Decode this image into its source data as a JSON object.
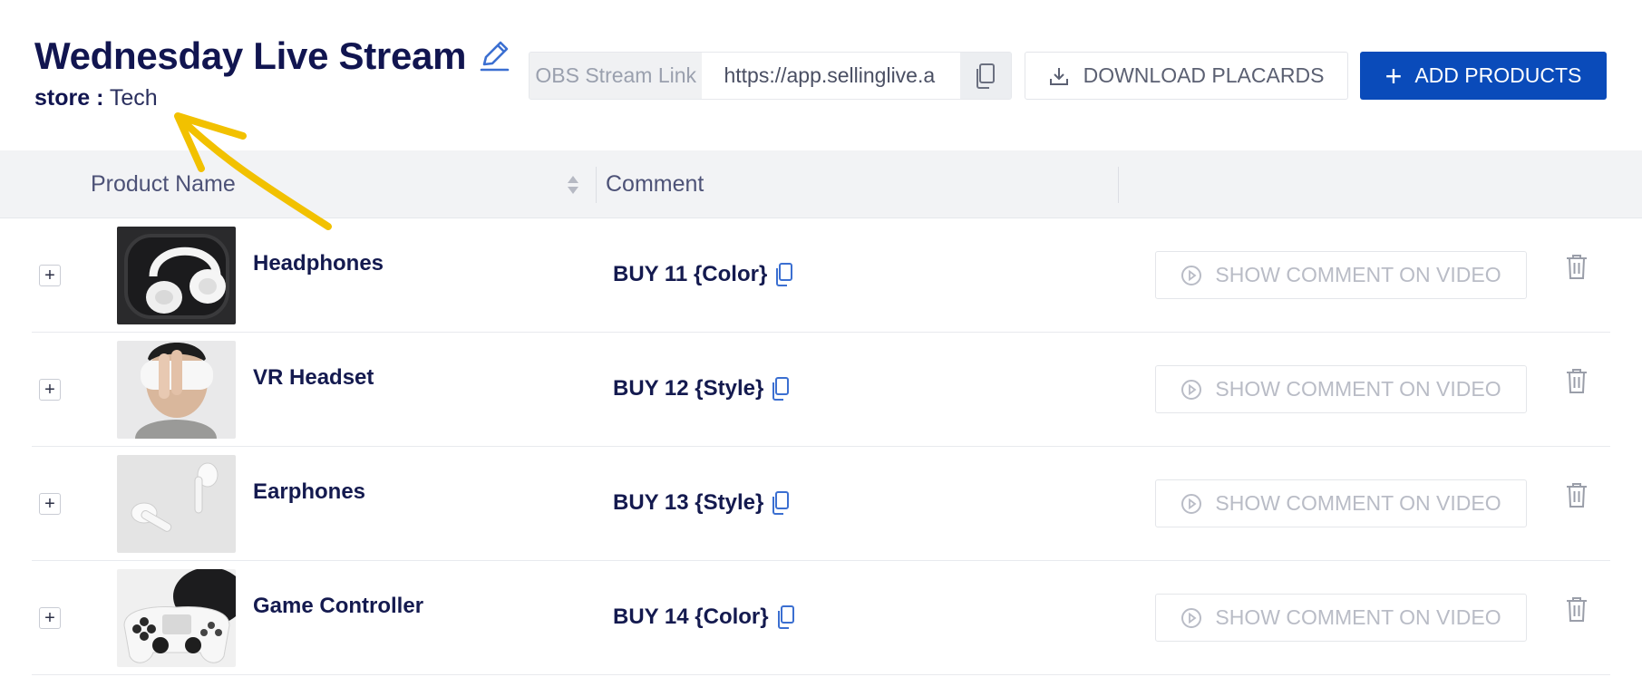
{
  "header": {
    "title": "Wednesday Live Stream",
    "store_label": "store :",
    "store_value": "Tech",
    "obs_label": "OBS Stream Link",
    "obs_value": "https://app.sellinglive.a",
    "download_label": "DOWNLOAD PLACARDS",
    "add_label": "ADD PRODUCTS"
  },
  "table": {
    "columns": [
      "Product Name",
      "Comment"
    ],
    "rows": [
      {
        "name": "Headphones",
        "comment": "BUY 11 {Color}",
        "action": "SHOW COMMENT ON VIDEO"
      },
      {
        "name": "VR Headset",
        "comment": "BUY 12 {Style}",
        "action": "SHOW COMMENT ON VIDEO"
      },
      {
        "name": "Earphones",
        "comment": "BUY 13 {Style}",
        "action": "SHOW COMMENT ON VIDEO"
      },
      {
        "name": "Game Controller",
        "comment": "BUY 14 {Color}",
        "action": "SHOW COMMENT ON VIDEO"
      }
    ]
  },
  "colors": {
    "accent": "#0a4bba",
    "title": "#111550",
    "annotation_arrow": "#f2c100"
  },
  "icons": [
    "edit-icon",
    "copy-icon",
    "download-icon",
    "plus-icon",
    "sort-icon",
    "play-circle-icon",
    "trash-icon"
  ]
}
